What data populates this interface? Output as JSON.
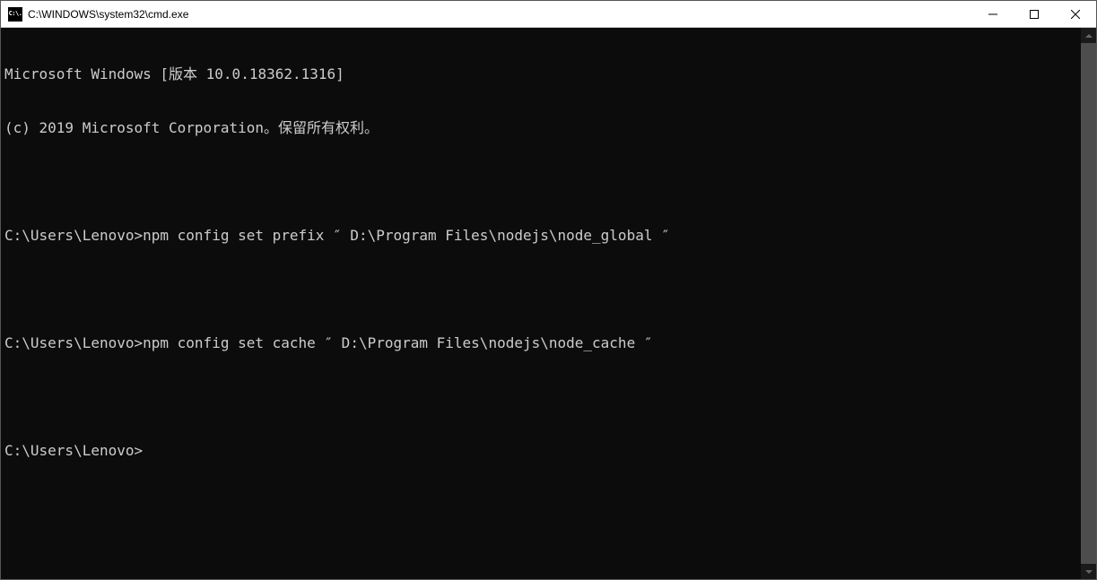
{
  "window": {
    "title": "C:\\WINDOWS\\system32\\cmd.exe",
    "icon_text": "C:\\."
  },
  "terminal": {
    "lines": [
      "Microsoft Windows [版本 10.0.18362.1316]",
      "(c) 2019 Microsoft Corporation。保留所有权利。",
      "",
      "C:\\Users\\Lenovo>npm config set prefix ″ D:\\Program Files\\nodejs\\node_global ″",
      "",
      "C:\\Users\\Lenovo>npm config set cache ″ D:\\Program Files\\nodejs\\node_cache ″",
      "",
      "C:\\Users\\Lenovo>"
    ]
  }
}
